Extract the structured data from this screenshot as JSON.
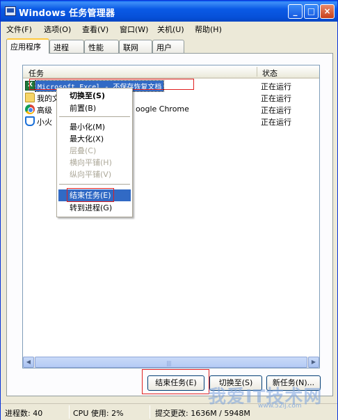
{
  "window": {
    "title": "Windows 任务管理器",
    "controls": [
      "_",
      "□",
      "×"
    ]
  },
  "menubar": [
    "文件(F)",
    "选项(O)",
    "查看(V)",
    "窗口(W)",
    "关机(U)",
    "帮助(H)"
  ],
  "tabs": [
    "应用程序",
    "进程",
    "性能",
    "联网",
    "用户"
  ],
  "list": {
    "columns": {
      "task": "任务",
      "status": "状态"
    },
    "rows": [
      {
        "icon": "excel-icon",
        "name": "Microsoft Excel - 不保存恢复文档",
        "status": "正在运行"
      },
      {
        "icon": "folder-icon",
        "name": "我的文",
        "status": "正在运行"
      },
      {
        "icon": "chrome-icon",
        "name": "高级",
        "name_tail": "oogle Chrome",
        "status": "正在运行"
      },
      {
        "icon": "shield-icon",
        "name": "小火",
        "status": "正在运行"
      }
    ]
  },
  "context_menu": {
    "items": [
      {
        "label": "切换至(S)",
        "bold": true
      },
      {
        "label": "前置(B)"
      },
      {
        "label": "最小化(M)"
      },
      {
        "label": "最大化(X)"
      },
      {
        "label": "层叠(C)",
        "disabled": true
      },
      {
        "label": "横向平铺(H)",
        "disabled": true
      },
      {
        "label": "纵向平铺(V)",
        "disabled": true
      },
      {
        "label": "结束任务(E)",
        "highlighted": true
      },
      {
        "label": "转到进程(G)"
      }
    ]
  },
  "buttons": {
    "end_task": "结束任务(E)",
    "switch_to": "切换至(S)",
    "new_task": "新任务(N)..."
  },
  "statusbar": {
    "processes": "进程数: 40",
    "cpu": "CPU 使用: 2%",
    "commit": "提交更改: 1636M / 5948M"
  },
  "watermark": {
    "text": "我爱IT技术网",
    "url": "www.52ij.com"
  }
}
